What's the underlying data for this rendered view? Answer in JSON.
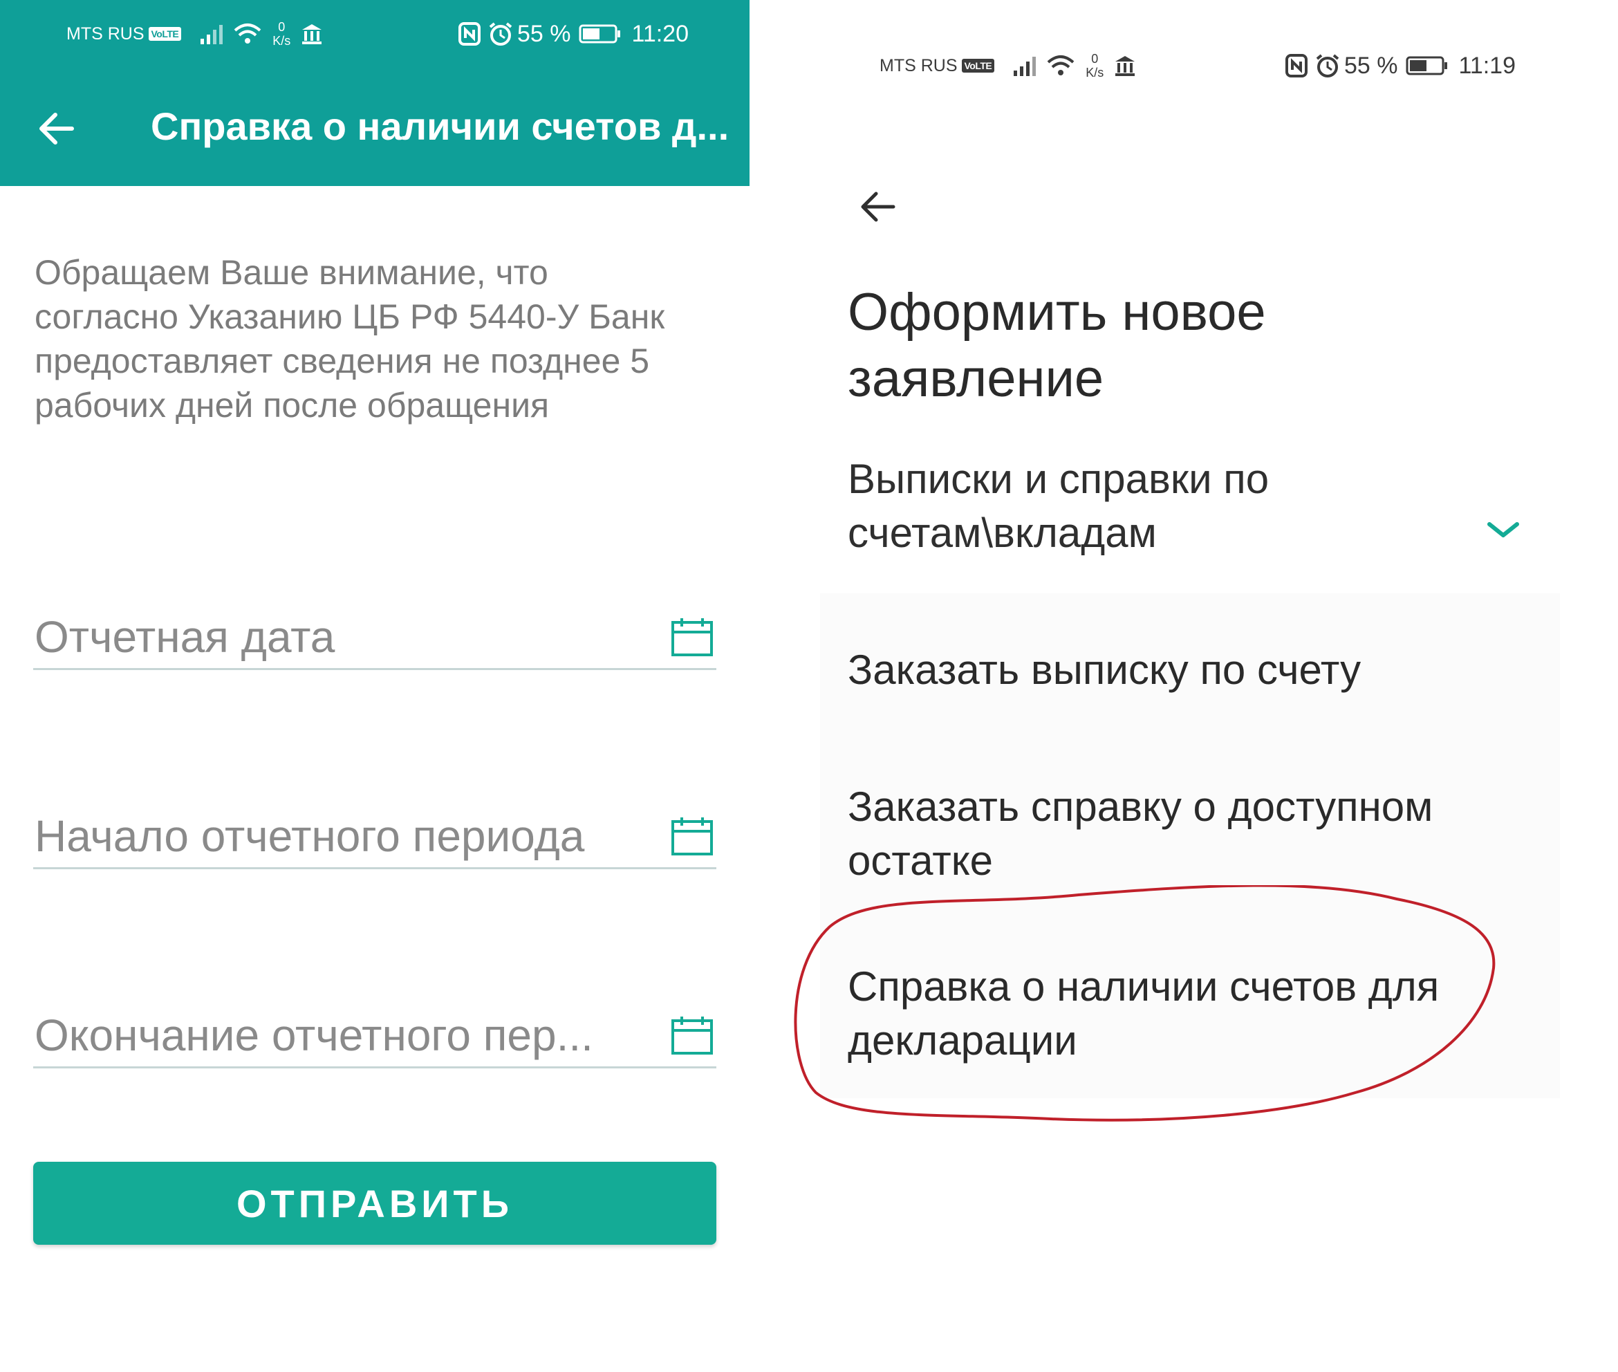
{
  "left_screen": {
    "status": {
      "carrier": "MTS RUS",
      "volte": "VoLTE",
      "net_value": "0",
      "net_unit": "K/s",
      "battery": "55 %",
      "time": "11:20"
    },
    "appbar": {
      "title": "Справка о наличии счетов д..."
    },
    "notice": "Обращаем Ваше внимание, что согласно Указанию ЦБ РФ 5440-У Банк предоставляет сведения не позднее 5 рабочих дней после обращения",
    "fields": {
      "report_date": "Отчетная дата",
      "period_start": "Начало отчетного периода",
      "period_end": "Окончание отчетного пер..."
    },
    "send_button": "ОТПРАВИТЬ"
  },
  "right_screen": {
    "status": {
      "carrier": "MTS RUS",
      "volte": "VoLTE",
      "net_value": "0",
      "net_unit": "K/s",
      "battery": "55 %",
      "time": "11:19"
    },
    "title": "Оформить новое заявление",
    "section": "Выписки и справки по счетам\\вкладам",
    "items": [
      "Заказать выписку по счету",
      "Заказать справку о доступном остатке",
      "Справка о наличии счетов для декларации"
    ]
  },
  "colors": {
    "appbar": "#0f9f98",
    "button": "#14ab96",
    "accent": "#14ab96",
    "highlight": "#c0202a"
  }
}
